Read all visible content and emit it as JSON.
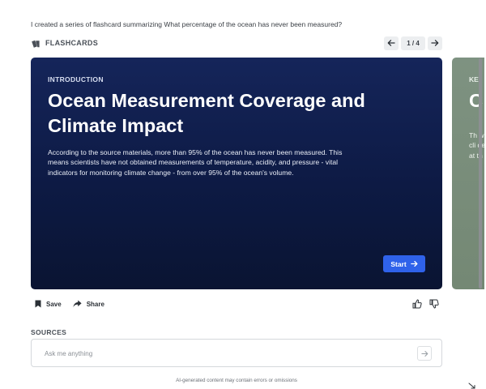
{
  "prompt": "I created a series of flashcard summarizing What percentage of the ocean has never been measured?",
  "flashcards": {
    "label": "FLASHCARDS",
    "icon": "cards-icon",
    "pager": {
      "prev_icon": "arrow-left-icon",
      "next_icon": "arrow-right-icon",
      "current": 1,
      "total": 4,
      "count_label": "1 / 4"
    },
    "current_card": {
      "section": "INTRODUCTION",
      "heading": "Ocean Measurement Coverage and Climate Impact",
      "body": "According to the source materials, more than 95% of the ocean has never been measured. This means scientists have not obtained measurements of temperature, acidity, and pressure - vital indicators for monitoring climate change - from over 95% of the ocean's volume.",
      "start_label": "Start",
      "background_color": "#0d1a44",
      "accent_color": "#2f62ea"
    },
    "next_card": {
      "section": "KE",
      "heading": "C",
      "body": "Th we cli de of at th",
      "background_color": "#7a8e7c"
    }
  },
  "actions": {
    "save_label": "Save",
    "share_label": "Share",
    "thumbs_up_icon": "thumbs-up-icon",
    "thumbs_down_icon": "thumbs-down-icon"
  },
  "sources": {
    "label": "SOURCES"
  },
  "ask": {
    "placeholder": "Ask me anything",
    "value": "",
    "send_icon": "arrow-right-icon"
  },
  "disclaimer": "AI-generated content may contain errors or omissions"
}
